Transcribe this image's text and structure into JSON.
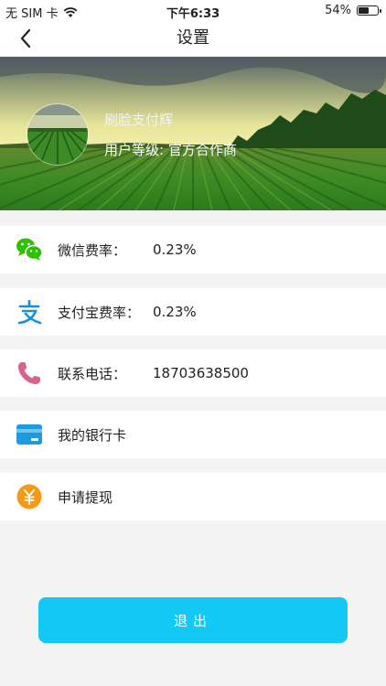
{
  "status_bar": {
    "carrier": "无 SIM 卡",
    "time": "下午6:33",
    "battery_percent": "54%"
  },
  "nav": {
    "title": "设置"
  },
  "profile": {
    "name": "刷脸支付辉",
    "level": "用户等级: 官方合作商"
  },
  "settings": [
    {
      "label": "微信费率：",
      "value": "0.23%"
    },
    {
      "label": "支付宝费率：",
      "value": "0.23%"
    },
    {
      "label": "联系电话：",
      "value": "18703638500"
    },
    {
      "label": "我的银行卡",
      "value": ""
    },
    {
      "label": "申请提现",
      "value": ""
    }
  ],
  "actions": {
    "logout_label": "退出"
  },
  "colors": {
    "accent": "#14c8f5",
    "wechat": "#2dc100",
    "alipay": "#1a8de3",
    "phone": "#d7648a",
    "bankcard": "#1e9be0",
    "withdraw": "#f59a14"
  }
}
